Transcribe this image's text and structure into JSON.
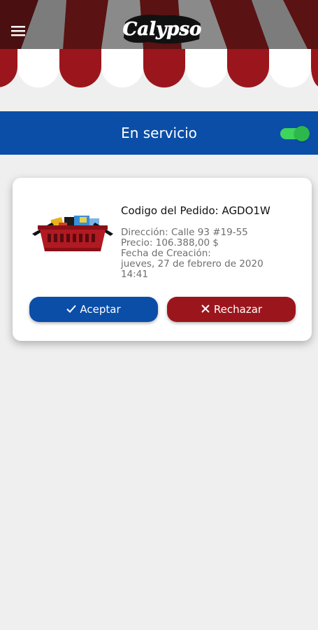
{
  "header": {
    "logo_text": "Calypso",
    "menu_icon": "hamburger-menu-icon",
    "colors": {
      "stripe_red": "#9b161c",
      "stripe_dark": "#5a1212",
      "awning_top": "#4a4a4a"
    }
  },
  "service": {
    "label": "En servicio",
    "toggle_on": true,
    "bar_color": "#0a4ea8",
    "toggle_color": "#3fd45b"
  },
  "order": {
    "title": "Codigo del Pedido: AGDO1W",
    "address": "Dirección: Calle 93 #19-55",
    "price": "Precio: 106.388,00 $",
    "created_label": "Fecha de Creación:",
    "created_date": "jueves, 27 de febrero de 2020",
    "created_time": "14:41",
    "image_icon": "shopping-basket-icon"
  },
  "actions": {
    "accept_label": "Aceptar",
    "accept_icon": "check-icon",
    "reject_label": "Rechazar",
    "reject_icon": "close-icon",
    "accept_color": "#0a4ea8",
    "reject_color": "#9b161c"
  }
}
